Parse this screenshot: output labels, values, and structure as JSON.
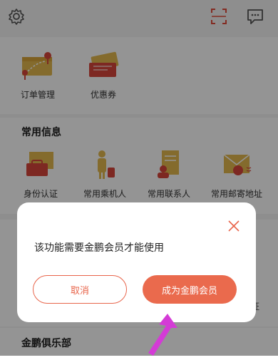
{
  "top_bar": {
    "icons": [
      "gear-icon",
      "scan-icon",
      "message-icon"
    ]
  },
  "shortcuts": [
    {
      "label": "订单管理",
      "icon": "ticket-icon"
    },
    {
      "label": "优惠券",
      "icon": "coupon-icon"
    }
  ],
  "common_info": {
    "title": "常用信息",
    "items": [
      {
        "label": "身份认证",
        "icon": "id-card-icon"
      },
      {
        "label": "常用乘机人",
        "icon": "passenger-icon"
      },
      {
        "label": "常用联系人",
        "icon": "contact-icon"
      },
      {
        "label": "常用邮寄地址",
        "icon": "mail-address-icon"
      }
    ]
  },
  "club": {
    "title": "金鹏俱乐部",
    "partial_label": "证"
  },
  "dialog": {
    "message": "该功能需要金鹏会员才能使用",
    "cancel_label": "取消",
    "confirm_label": "成为金鹏会员"
  },
  "colors": {
    "accent": "#ea6a4d",
    "overlay": "rgba(0,0,0,0.42)",
    "arrow": "#d43bd6"
  }
}
